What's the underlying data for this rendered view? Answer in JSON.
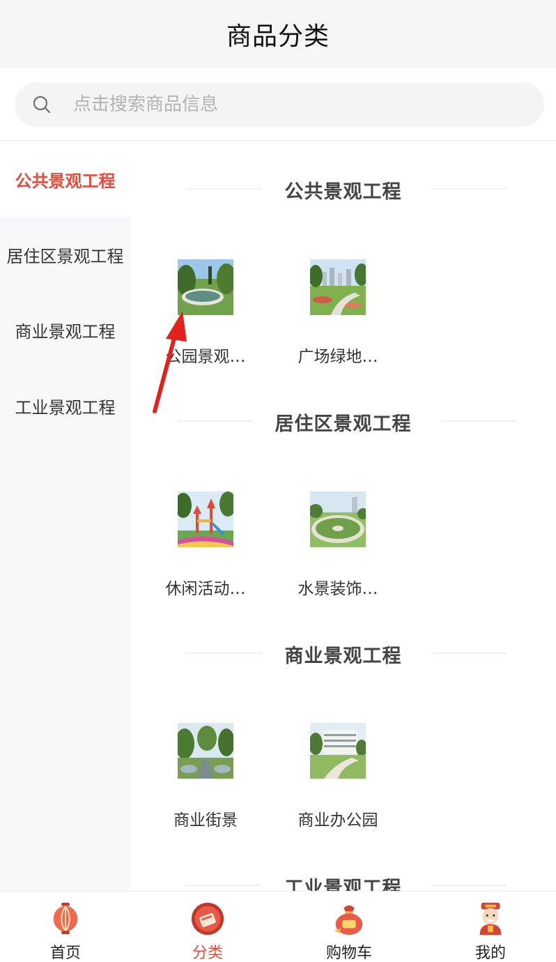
{
  "header": {
    "title": "商品分类"
  },
  "search": {
    "placeholder": "点击搜索商品信息"
  },
  "sidebar": {
    "items": [
      {
        "label": "公共景观工程",
        "active": true
      },
      {
        "label": "居住区景观工程",
        "active": false
      },
      {
        "label": "商业景观工程",
        "active": false
      },
      {
        "label": "工业景观工程",
        "active": false
      }
    ]
  },
  "sections": [
    {
      "title": "公共景观工程",
      "products": [
        {
          "name": "公园景观…"
        },
        {
          "name": "广场绿地…"
        }
      ]
    },
    {
      "title": "居住区景观工程",
      "products": [
        {
          "name": "休闲活动…"
        },
        {
          "name": "水景装饰…"
        }
      ]
    },
    {
      "title": "商业景观工程",
      "products": [
        {
          "name": "商业街景"
        },
        {
          "name": "商业办公园"
        }
      ]
    },
    {
      "title": "工业景观工程",
      "products": []
    }
  ],
  "tabbar": {
    "tabs": [
      {
        "label": "首页",
        "icon": "lantern-icon"
      },
      {
        "label": "分类",
        "icon": "category-icon",
        "active": true
      },
      {
        "label": "购物车",
        "icon": "lucky-bag-icon"
      },
      {
        "label": "我的",
        "icon": "fortune-god-icon"
      }
    ]
  },
  "colors": {
    "accent": "#e64c3c",
    "sidebar_bg": "#f8f7fa",
    "header_bg": "#f6f6f6"
  }
}
